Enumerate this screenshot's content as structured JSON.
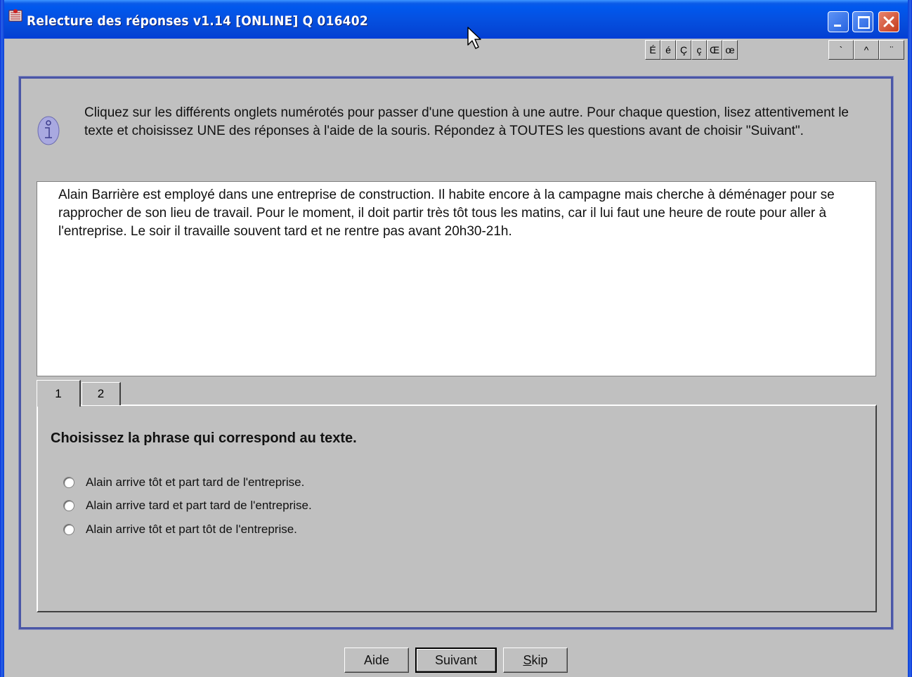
{
  "window": {
    "title": "Relecture des réponses v1.14  [ONLINE] Q 016402"
  },
  "char_toolbar": {
    "chars": [
      "É",
      "é",
      "Ç",
      "ç",
      "Œ",
      "œ"
    ],
    "accents": [
      "`",
      "^",
      "¨"
    ]
  },
  "instructions": "Cliquez sur les différents onglets numérotés pour passer d'une question à une autre. Pour chaque question, lisez attentivement le texte et choisissez  UNE des réponses à l'aide de la souris. Répondez à TOUTES les questions avant de choisir \"Suivant\".",
  "passage": "Alain Barrière est employé dans une entreprise de construction. Il habite encore à la campagne mais cherche à déménager pour se rapprocher de son lieu de travail. Pour le moment, il doit partir très tôt tous les matins, car il lui faut une heure de route pour aller à l'entreprise. Le soir il travaille souvent tard et ne rentre pas avant 20h30-21h.",
  "tabs": [
    {
      "label": "1",
      "selected": true
    },
    {
      "label": "2",
      "selected": false
    }
  ],
  "question": {
    "prompt": "Choisissez la phrase qui correspond au texte.",
    "options": [
      "Alain arrive tôt et part tard de l'entreprise.",
      "Alain arrive tard et part tard de l'entreprise.",
      "Alain arrive tôt et part tôt de l'entreprise."
    ]
  },
  "buttons": {
    "help": "Aide",
    "next": "Suivant",
    "skip_first": "S",
    "skip_rest": "kip"
  },
  "colors": {
    "titlebar": "#0550e0",
    "close": "#c43b1a",
    "panel_border": "#4a56a6"
  }
}
